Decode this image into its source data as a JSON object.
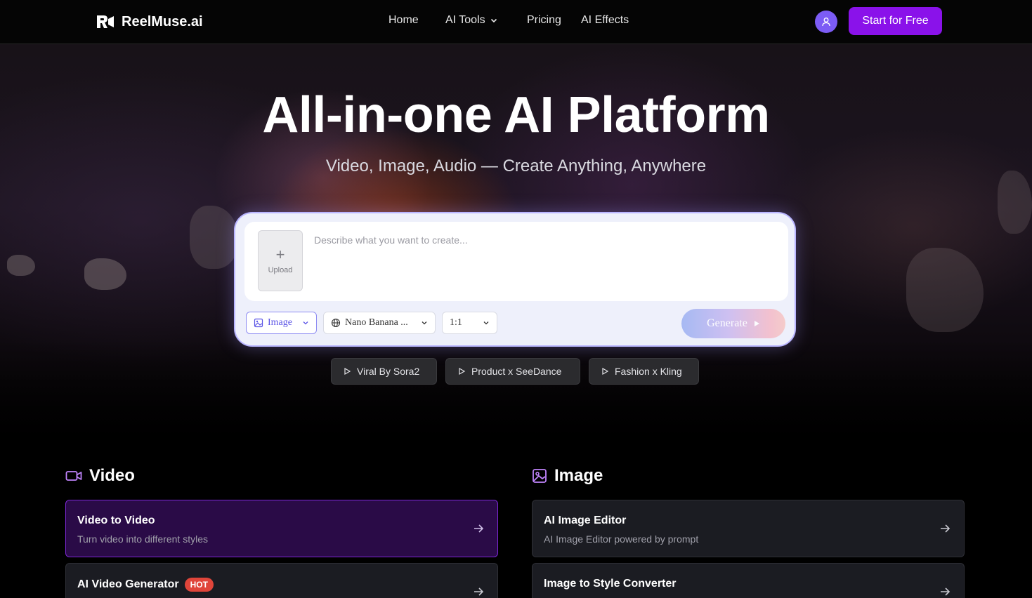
{
  "header": {
    "logo_text": "ReelMuse.ai",
    "nav": [
      {
        "label": "Home"
      },
      {
        "label": "AI Tools"
      },
      {
        "label": "Pricing"
      },
      {
        "label": "AI Effects"
      }
    ],
    "cta_label": "Start for Free"
  },
  "hero": {
    "title": "All-in-one AI Platform",
    "subtitle": "Video, Image, Audio — Create Anything, Anywhere"
  },
  "prompt": {
    "placeholder": "Describe what you want to create...",
    "upload_label": "Upload",
    "mode_label": "Image",
    "model_label": "Nano Banana ...",
    "ratio_label": "1:1",
    "generate_label": "Generate"
  },
  "presets": [
    {
      "label": "Viral By Sora2"
    },
    {
      "label": "Product x SeeDance"
    },
    {
      "label": "Fashion x Kling"
    }
  ],
  "video_section": {
    "title": "Video",
    "cards": [
      {
        "title": "Video to Video",
        "desc": "Turn video into different styles"
      },
      {
        "title": "AI Video Generator",
        "badge": "HOT"
      }
    ]
  },
  "image_section": {
    "title": "Image",
    "cards": [
      {
        "title": "AI Image Editor",
        "desc": "AI Image Editor powered by prompt"
      },
      {
        "title": "Image to Style Converter"
      }
    ]
  },
  "colors": {
    "brand_purple": "#8a12ea",
    "avatar": "#7c5cf5",
    "hot_badge": "#e0453a",
    "featured_card_border": "#7d27d6"
  }
}
